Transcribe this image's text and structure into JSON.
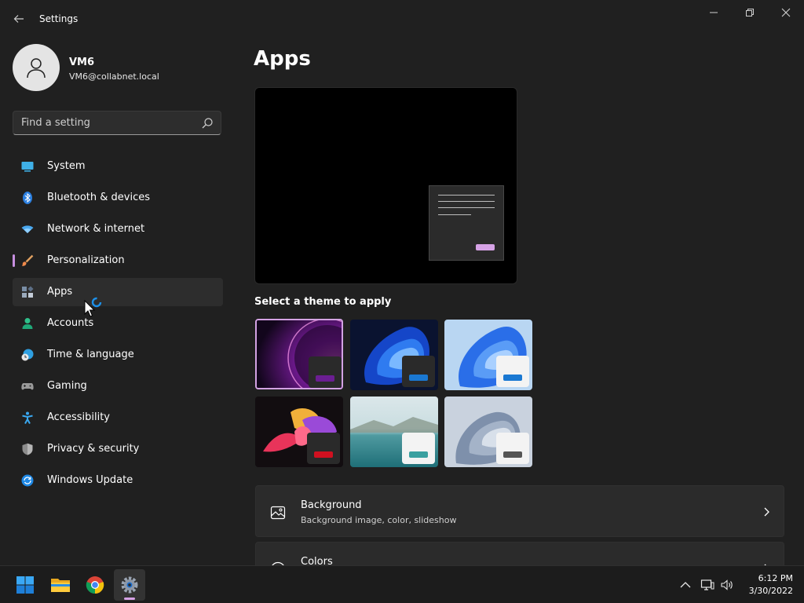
{
  "window": {
    "title": "Settings"
  },
  "profile": {
    "name": "VM6",
    "email": "VM6@collabnet.local"
  },
  "search": {
    "placeholder": "Find a setting"
  },
  "nav": {
    "selected": "Apps",
    "items": [
      {
        "label": "System",
        "icon": "system-icon"
      },
      {
        "label": "Bluetooth & devices",
        "icon": "bluetooth-icon"
      },
      {
        "label": "Network & internet",
        "icon": "wifi-icon"
      },
      {
        "label": "Personalization",
        "icon": "brush-icon"
      },
      {
        "label": "Apps",
        "icon": "apps-icon"
      },
      {
        "label": "Accounts",
        "icon": "person-icon"
      },
      {
        "label": "Time & language",
        "icon": "clock-globe-icon"
      },
      {
        "label": "Gaming",
        "icon": "gamepad-icon"
      },
      {
        "label": "Accessibility",
        "icon": "accessibility-icon"
      },
      {
        "label": "Privacy & security",
        "icon": "shield-icon"
      },
      {
        "label": "Windows Update",
        "icon": "update-icon"
      }
    ]
  },
  "main": {
    "title": "Apps",
    "theme_heading": "Select a theme to apply",
    "themes": [
      {
        "name": "windows-glow",
        "chip_accent": "#6b1e92",
        "chip_bg": "#2a2a2a",
        "selected": true
      },
      {
        "name": "windows-dark",
        "chip_accent": "#1a78d2",
        "chip_bg": "#2a2a2a",
        "selected": false
      },
      {
        "name": "windows-light",
        "chip_accent": "#1a78d2",
        "chip_bg": "#f3f3f3",
        "selected": false
      },
      {
        "name": "captured-motion",
        "chip_accent": "#d01020",
        "chip_bg": "#2a2a2a",
        "selected": false
      },
      {
        "name": "sunrise-lake",
        "chip_accent": "#3aa0a0",
        "chip_bg": "#f3f3f3",
        "selected": false
      },
      {
        "name": "flow",
        "chip_accent": "#555555",
        "chip_bg": "#f3f3f3",
        "selected": false
      }
    ],
    "cards": [
      {
        "title": "Background",
        "subtitle": "Background image, color, slideshow",
        "icon": "image-icon"
      },
      {
        "title": "Colors",
        "subtitle": "",
        "icon": "palette-icon"
      }
    ]
  },
  "taskbar": {
    "apps": [
      "windows-start-icon",
      "file-explorer-icon",
      "chrome-icon",
      "settings-gear-icon"
    ],
    "active_app": "settings-gear-icon",
    "time": "6:12 PM",
    "date": "3/30/2022"
  },
  "colors": {
    "accent": "#d6a2e6",
    "background": "#202020",
    "card": "#2b2b2b"
  }
}
